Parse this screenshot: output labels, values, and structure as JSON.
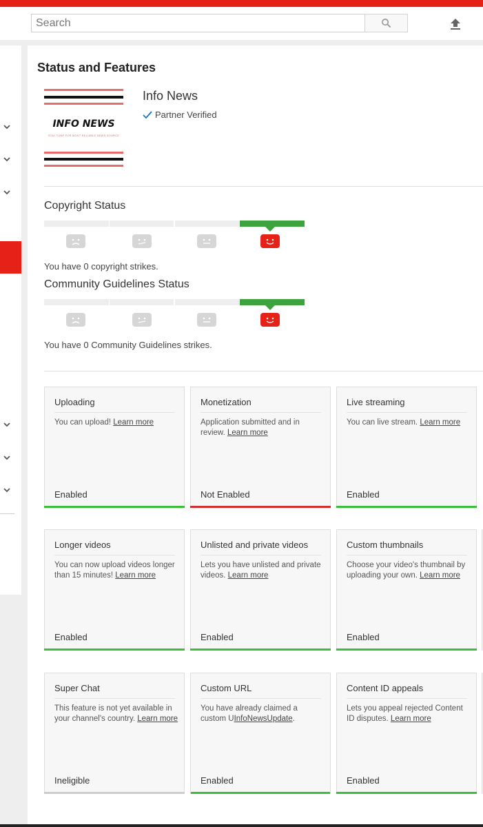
{
  "header": {
    "search_placeholder": "Search"
  },
  "page": {
    "title": "Status and Features",
    "channel_name": "Info News",
    "partner_label": "Partner Verified",
    "logo_text": "INFO NEWS",
    "logo_tagline": "STAY TUNE FOR MOST RELIABLE NEWS SOURCE"
  },
  "copyright": {
    "title": "Copyright Status",
    "strikes_text": "You have 0 copyright strikes.",
    "level": 4,
    "levels": 4
  },
  "community": {
    "title": "Community Guidelines Status",
    "strikes_text": "You have 0 Community Guidelines strikes.",
    "level": 4,
    "levels": 4
  },
  "colors": {
    "brand_red": "#e62117",
    "enabled_green": "#3bbf3b",
    "not_enabled_red": "#d32f2f",
    "ineligible_grey": "#cccccc"
  },
  "features": [
    {
      "title": "Uploading",
      "desc_text": "You can upload! ",
      "link": "Learn more",
      "desc_after": "",
      "status": "Enabled",
      "status_color": "#3bbf3b"
    },
    {
      "title": "Monetization",
      "desc_text": "Application submitted and in review. ",
      "link": "Learn more",
      "desc_after": "",
      "status": "Not Enabled",
      "status_color": "#d32f2f"
    },
    {
      "title": "Live streaming",
      "desc_text": "You can live stream. ",
      "link": "Learn more",
      "desc_after": "",
      "status": "Enabled",
      "status_color": "#3bbf3b"
    },
    {
      "title": "Longer videos",
      "desc_text": "You can now upload videos longer than 15 minutes! ",
      "link": "Learn more",
      "desc_after": "",
      "status": "Enabled",
      "status_color": "#3bbf3b"
    },
    {
      "title": "Unlisted and private videos",
      "desc_text": "Lets you have unlisted and private videos. ",
      "link": "Learn more",
      "desc_after": "",
      "status": "Enabled",
      "status_color": "#3bbf3b"
    },
    {
      "title": "Custom thumbnails",
      "desc_text": "Choose your video's thumbnail by uploading your own. ",
      "link": "Learn more",
      "desc_after": "",
      "status": "Enabled",
      "status_color": "#3bbf3b"
    },
    {
      "title": "Super Chat",
      "desc_text": "This feature is not yet available in your channel's country. ",
      "link": "Learn more",
      "desc_after": "",
      "status": "Ineligible",
      "status_color": "#cccccc"
    },
    {
      "title": "Custom URL",
      "desc_text": "You have already claimed a custom U",
      "link": "InfoNewsUpdate",
      "desc_after": ".",
      "status": "Enabled",
      "status_color": "#3bbf3b"
    },
    {
      "title": "Content ID appeals",
      "desc_text": "Lets you appeal rejected Content ID disputes. ",
      "link": "Learn more",
      "desc_after": "",
      "status": "Enabled",
      "status_color": "#3bbf3b"
    }
  ]
}
